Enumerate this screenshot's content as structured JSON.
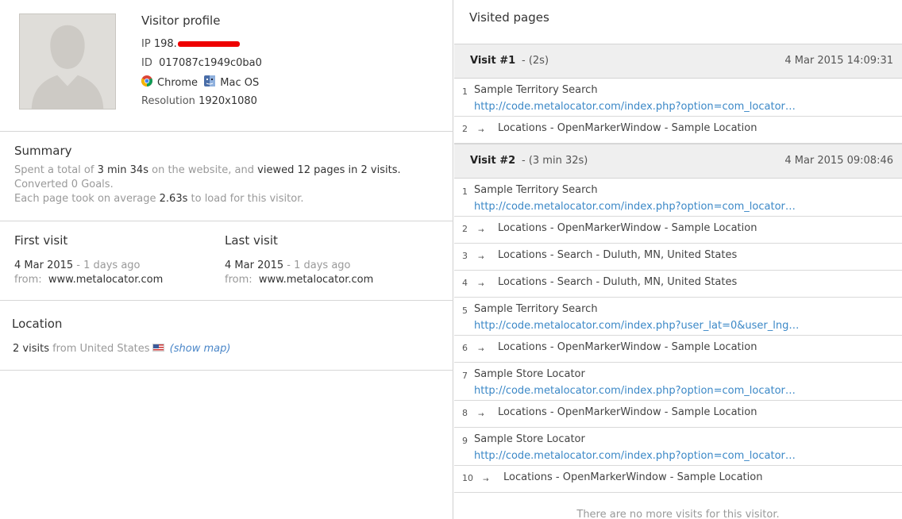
{
  "profile": {
    "title": "Visitor profile",
    "ip_label": "IP",
    "ip_value": "198.",
    "id_label": "ID",
    "id_value": "017087c1949c0ba0",
    "browser": "Chrome",
    "browser_icon": "chrome-icon",
    "os": "Mac OS",
    "os_icon": "mac-finder-icon",
    "resolution_label": "Resolution",
    "resolution_value": "1920x1080"
  },
  "summary": {
    "title": "Summary",
    "spent_pre": "Spent a total of",
    "spent_time": "3 min 34s",
    "spent_mid": "on the website, and",
    "viewed": "viewed 12 pages in 2 visits.",
    "converted": "Converted 0 Goals.",
    "load_pre": "Each page took on average",
    "load_time": "2.63s",
    "load_post": "to load for this visitor."
  },
  "first_visit": {
    "title": "First visit",
    "date": "4 Mar 2015",
    "ago": " - 1 days ago",
    "from_label": "from:",
    "from": "www.metalocator.com"
  },
  "last_visit": {
    "title": "Last visit",
    "date": "4 Mar 2015",
    "ago": " - 1 days ago",
    "from_label": "from:",
    "from": "www.metalocator.com"
  },
  "location": {
    "title": "Location",
    "visits": "2 visits",
    "from_text": "from United States",
    "show_map": "(show map)"
  },
  "visited": {
    "title": "Visited pages",
    "visits": [
      {
        "name": "Visit #1",
        "duration": "- (2s)",
        "date": "4 Mar 2015 14:09:31",
        "pages": [
          {
            "num": "1",
            "title": "Sample Territory Search",
            "url": "http://code.metalocator.com/index.php?option=com_locator…"
          },
          {
            "num": "2",
            "event": "Locations - OpenMarkerWindow - Sample Location"
          }
        ]
      },
      {
        "name": "Visit #2",
        "duration": "- (3 min 32s)",
        "date": "4 Mar 2015 09:08:46",
        "pages": [
          {
            "num": "1",
            "title": "Sample Territory Search",
            "url": "http://code.metalocator.com/index.php?option=com_locator…"
          },
          {
            "num": "2",
            "event": "Locations - OpenMarkerWindow - Sample Location"
          },
          {
            "num": "3",
            "event": "Locations - Search - Duluth, MN, United States"
          },
          {
            "num": "4",
            "event": "Locations - Search - Duluth, MN, United States"
          },
          {
            "num": "5",
            "title": "Sample Territory Search",
            "url": "http://code.metalocator.com/index.php?user_lat=0&user_lng…"
          },
          {
            "num": "6",
            "event": "Locations - OpenMarkerWindow - Sample Location"
          },
          {
            "num": "7",
            "title": "Sample Store Locator",
            "url": "http://code.metalocator.com/index.php?option=com_locator…"
          },
          {
            "num": "8",
            "event": "Locations - OpenMarkerWindow - Sample Location"
          },
          {
            "num": "9",
            "title": "Sample Store Locator",
            "url": "http://code.metalocator.com/index.php?option=com_locator…"
          },
          {
            "num": "10",
            "event": "Locations - OpenMarkerWindow - Sample Location"
          }
        ]
      }
    ],
    "no_more": "There are no more visits for this visitor."
  }
}
